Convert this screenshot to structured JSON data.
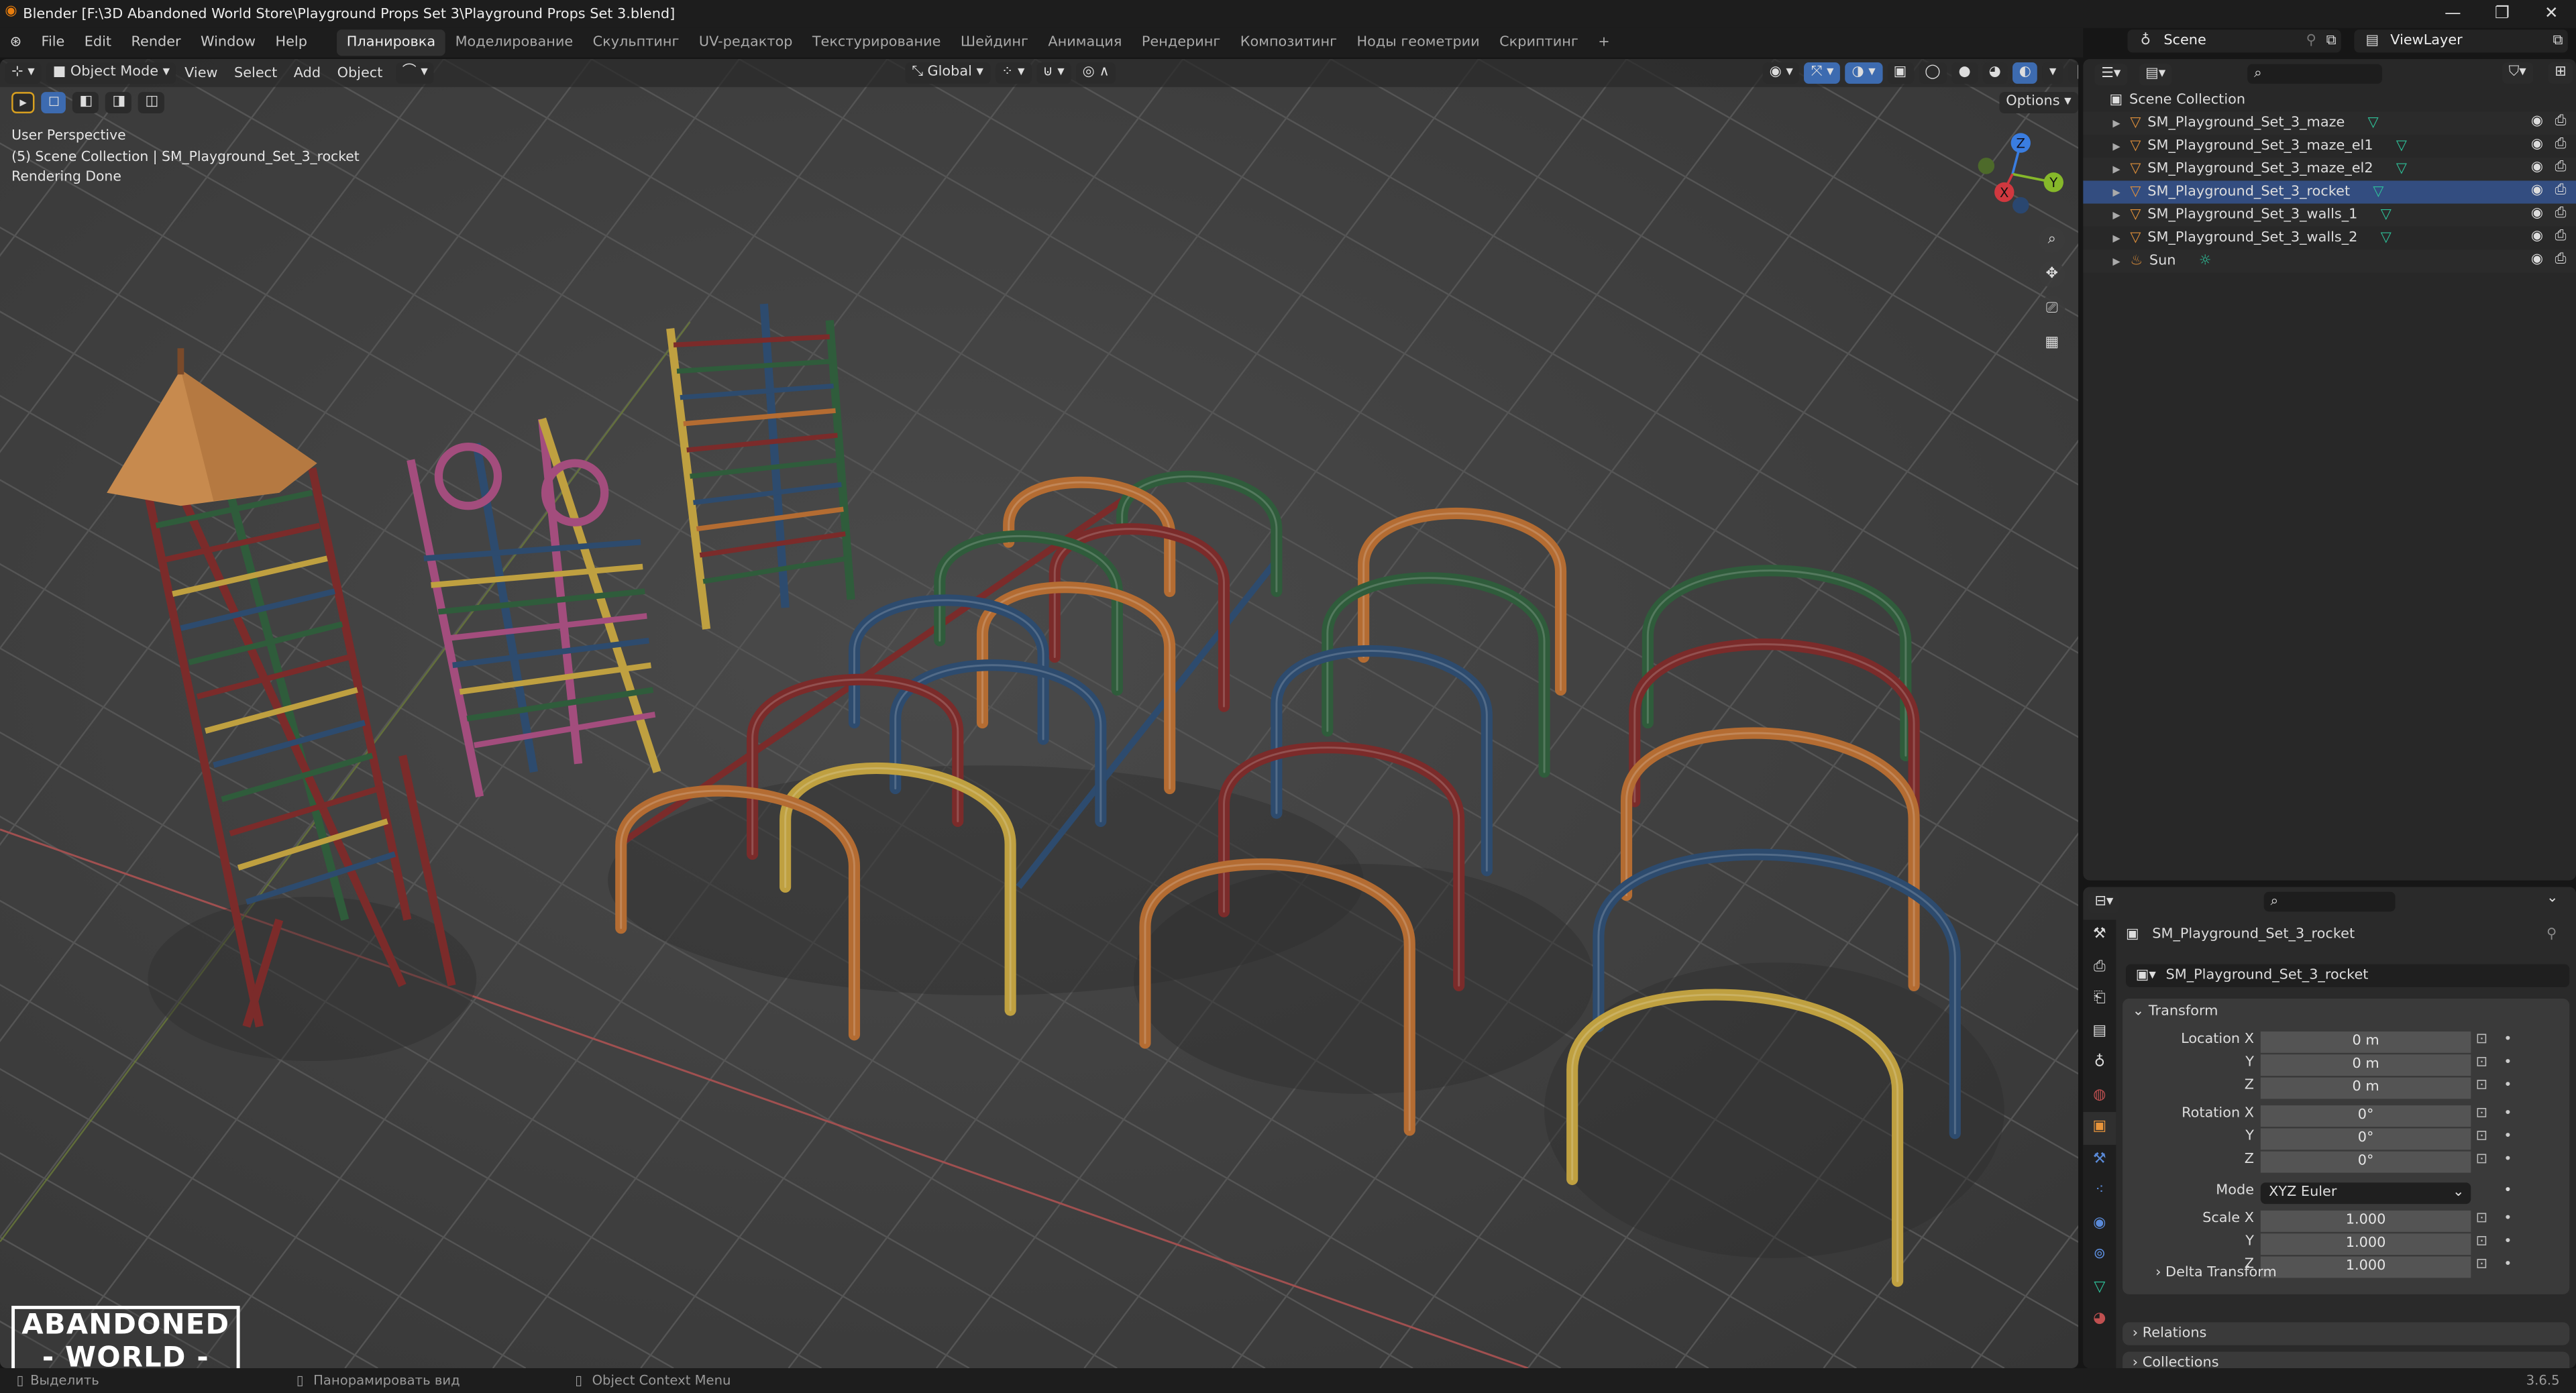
{
  "window": {
    "title": "Blender [F:\\3D Abandoned World Store\\Playground Props Set 3\\Playground Props Set 3.blend]",
    "minimize": "—",
    "maximize": "❐",
    "close": "✕"
  },
  "menu": [
    "File",
    "Edit",
    "Render",
    "Window",
    "Help"
  ],
  "workspaces": [
    "Планировка",
    "Моделирование",
    "Скульптинг",
    "UV-редактор",
    "Текстурирование",
    "Шейдинг",
    "Анимация",
    "Рендеринг",
    "Композитинг",
    "Ноды геометрии",
    "Скриптинг"
  ],
  "add_workspace": "+",
  "scene": {
    "label": "Scene",
    "view_layer": "ViewLayer"
  },
  "viewport": {
    "mode": "Object Mode",
    "menus": [
      "View",
      "Select",
      "Add",
      "Object"
    ],
    "orientation": "Global",
    "options": "Options",
    "overlay": [
      "User Perspective",
      "(5) Scene Collection | SM_Playground_Set_3_rocket",
      "Rendering Done"
    ],
    "gizmo": {
      "x": "X",
      "y": "Y",
      "z": "Z"
    },
    "colors": {
      "red": "#7b2b2a",
      "orange": "#b46c32",
      "yellow": "#bfa040",
      "blue": "#2d4b6e",
      "green": "#2f5c3b",
      "pink": "#a34d7d",
      "cone": "#c78a4e"
    }
  },
  "outliner": {
    "root": "Scene Collection",
    "items": [
      {
        "name": "SM_Playground_Set_3_maze",
        "type": "mesh"
      },
      {
        "name": "SM_Playground_Set_3_maze_el1",
        "type": "mesh"
      },
      {
        "name": "SM_Playground_Set_3_maze_el2",
        "type": "mesh"
      },
      {
        "name": "SM_Playground_Set_3_rocket",
        "type": "mesh",
        "active": true
      },
      {
        "name": "SM_Playground_Set_3_walls_1",
        "type": "mesh"
      },
      {
        "name": "SM_Playground_Set_3_walls_2",
        "type": "mesh"
      },
      {
        "name": "Sun",
        "type": "light"
      }
    ]
  },
  "properties": {
    "object_name": "SM_Playground_Set_3_rocket",
    "name_field": "SM_Playground_Set_3_rocket",
    "transform": {
      "title": "Transform",
      "location": {
        "label": "Location X",
        "x": "0 m",
        "y": "0 m",
        "z": "0 m"
      },
      "rotation": {
        "label": "Rotation X",
        "x": "0°",
        "y": "0°",
        "z": "0°"
      },
      "mode": {
        "label": "Mode",
        "value": "XYZ Euler"
      },
      "scale": {
        "label": "Scale X",
        "x": "1.000",
        "y": "1.000",
        "z": "1.000"
      },
      "axis_y": "Y",
      "axis_z": "Z"
    },
    "delta": "Delta Transform",
    "relations": "Relations",
    "collections": "Collections"
  },
  "status": {
    "select": "Выделить",
    "pan": "Панорамировать вид",
    "context": "Object Context Menu",
    "version": "3.6.5"
  },
  "logo": {
    "line1": "ABANDONED",
    "line2": "- WORLD -"
  }
}
